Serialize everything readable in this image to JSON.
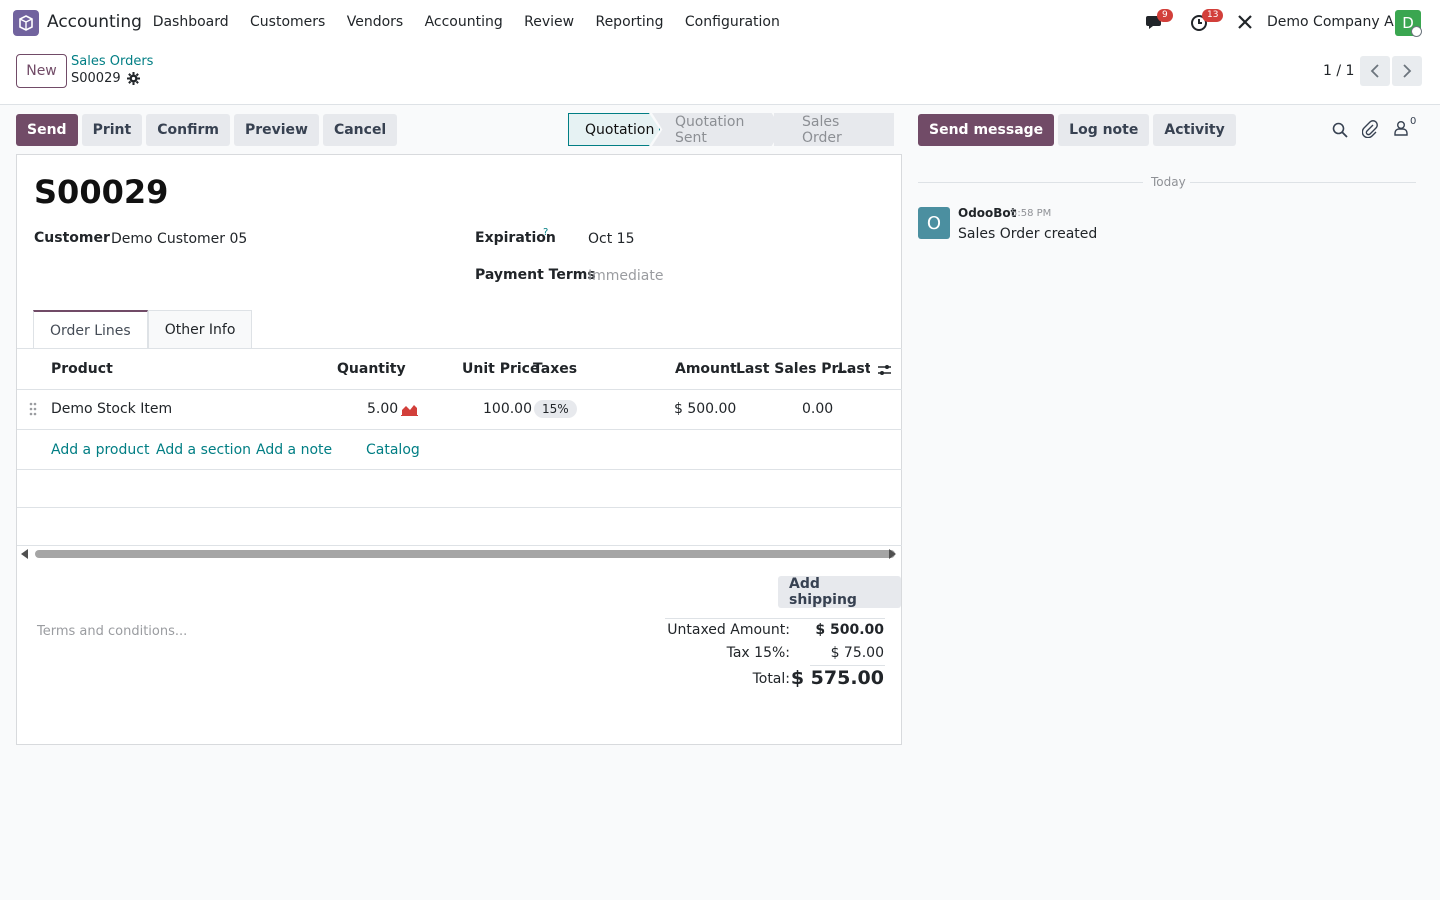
{
  "navbar": {
    "app_name": "Accounting",
    "menu": [
      "Dashboard",
      "Customers",
      "Vendors",
      "Accounting",
      "Review",
      "Reporting",
      "Configuration"
    ],
    "messages_badge": "9",
    "activities_badge": "13",
    "company": "Demo Company A",
    "avatar_letter": "D"
  },
  "control": {
    "new_label": "New",
    "breadcrumb_parent": "Sales Orders",
    "breadcrumb_current": "S00029",
    "pager": "1 / 1"
  },
  "actions": {
    "send": "Send",
    "print": "Print",
    "confirm": "Confirm",
    "preview": "Preview",
    "cancel": "Cancel"
  },
  "stages": {
    "quotation": "Quotation",
    "sent": "Quotation Sent",
    "order": "Sales Order"
  },
  "form": {
    "title": "S00029",
    "customer_label": "Customer",
    "customer_value": "Demo Customer 05",
    "expiration_label": "Expiration",
    "expiration_help": "?",
    "expiration_value": "Oct 15",
    "payment_label": "Payment Terms",
    "payment_value": "Immediate"
  },
  "tabs": {
    "order_lines": "Order Lines",
    "other_info": "Other Info"
  },
  "table": {
    "headers": {
      "product": "Product",
      "quantity": "Quantity",
      "unit_price": "Unit Price",
      "taxes": "Taxes",
      "amount": "Amount",
      "last_sales_price": "Last Sales Pr...",
      "last_truncated": "Last S"
    },
    "rows": [
      {
        "product": "Demo Stock Item",
        "quantity": "5.00",
        "unit_price": "100.00",
        "taxes": "15%",
        "amount": "$ 500.00",
        "last_sales_price": "0.00"
      }
    ],
    "add_product": "Add a product",
    "add_section": "Add a section",
    "add_note": "Add a note",
    "catalog": "Catalog"
  },
  "footer": {
    "add_shipping": "Add shipping",
    "terms_placeholder": "Terms and conditions...",
    "untaxed_label": "Untaxed Amount:",
    "untaxed_value": "$ 500.00",
    "tax_label": "Tax 15%:",
    "tax_value": "$ 75.00",
    "total_label": "Total:",
    "total_value": "$ 575.00"
  },
  "chatter": {
    "send_message": "Send message",
    "log_note": "Log note",
    "activity": "Activity",
    "followers_count": "0",
    "today": "Today",
    "author": "OdooBot",
    "time": "5:58 PM",
    "message": "Sales Order created",
    "author_initial": "O"
  },
  "colors": {
    "primary": "#714b67",
    "link": "#017e84",
    "badge": "#d23f3a"
  }
}
